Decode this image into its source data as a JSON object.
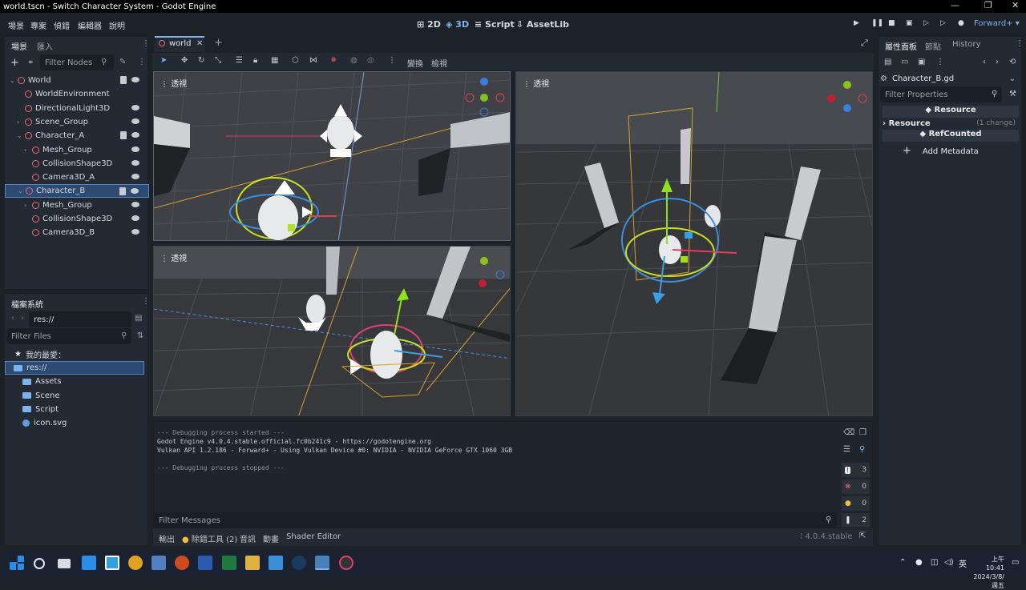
{
  "window": {
    "title": "world.tscn - Switch Character System - Godot Engine"
  },
  "menu": [
    "場景",
    "專案",
    "偵錯",
    "編輯器",
    "說明"
  ],
  "modes": {
    "two_d": "2D",
    "three_d": "3D",
    "script": "Script",
    "assetlib": "AssetLib"
  },
  "renderer": "Forward+",
  "scene_dock": {
    "tabs": [
      "場景",
      "匯入"
    ],
    "filter_placeholder": "Filter Nodes",
    "nodes": [
      {
        "label": "World",
        "indent": 0,
        "icon": "node3d-icon",
        "color": "#f06b6b",
        "script": true,
        "eye": true
      },
      {
        "label": "WorldEnvironment",
        "indent": 1,
        "icon": "globe-icon",
        "color": "#f06b6b",
        "script": false,
        "eye": false
      },
      {
        "label": "DirectionalLight3D",
        "indent": 1,
        "icon": "light-icon",
        "color": "#f06b6b",
        "script": false,
        "eye": true
      },
      {
        "label": "Scene_Group",
        "indent": 1,
        "icon": "node3d-icon",
        "color": "#f06b6b",
        "script": false,
        "eye": true
      },
      {
        "label": "Character_A",
        "indent": 1,
        "icon": "body-icon",
        "color": "#f06b6b",
        "script": true,
        "eye": true
      },
      {
        "label": "Mesh_Group",
        "indent": 2,
        "icon": "node3d-icon",
        "color": "#f06b6b",
        "script": false,
        "eye": true
      },
      {
        "label": "CollisionShape3D",
        "indent": 2,
        "icon": "collision-icon",
        "color": "#f06b6b",
        "script": false,
        "eye": true
      },
      {
        "label": "Camera3D_A",
        "indent": 2,
        "icon": "camera-icon",
        "color": "#f06b6b",
        "script": false,
        "eye": true
      },
      {
        "label": "Character_B",
        "indent": 1,
        "icon": "body-icon",
        "color": "#f06b6b",
        "script": true,
        "eye": true,
        "selected": true
      },
      {
        "label": "Mesh_Group",
        "indent": 2,
        "icon": "node3d-icon",
        "color": "#f06b6b",
        "script": false,
        "eye": true
      },
      {
        "label": "CollisionShape3D",
        "indent": 2,
        "icon": "collision-icon",
        "color": "#f06b6b",
        "script": false,
        "eye": true
      },
      {
        "label": "Camera3D_B",
        "indent": 2,
        "icon": "camera-icon",
        "color": "#f06b6b",
        "script": false,
        "eye": true
      }
    ]
  },
  "filesystem": {
    "title": "檔案系統",
    "path": "res://",
    "filter_placeholder": "Filter Files",
    "favorites": "我的最愛：",
    "items": [
      {
        "label": "res://",
        "indent": 0,
        "type": "folder"
      },
      {
        "label": "Assets",
        "indent": 1,
        "type": "folder"
      },
      {
        "label": "Scene",
        "indent": 1,
        "type": "folder"
      },
      {
        "label": "Script",
        "indent": 1,
        "type": "folder"
      },
      {
        "label": "icon.svg",
        "indent": 1,
        "type": "file"
      }
    ]
  },
  "editor": {
    "scene_tab": "world",
    "toolbar_labels": {
      "transform": "變換",
      "view": "檢視"
    },
    "viewport_label": "透視"
  },
  "output": {
    "lines": [
      "--- Debugging process started ---",
      "Godot Engine v4.0.4.stable.official.fc0b241c9 - https://godotengine.org",
      "Vulkan API 1.2.186 - Forward+ - Using Vulkan Device #0: NVIDIA - NVIDIA GeForce GTX 1060 3GB",
      "",
      "--- Debugging process stopped ---"
    ],
    "filter_placeholder": "Filter Messages",
    "counts": {
      "messages": "3",
      "errors": "0",
      "warnings": "0",
      "editor": "2"
    }
  },
  "bottom_tabs": [
    "輸出",
    "除錯工具 (2)",
    "音訊",
    "動畫",
    "Shader Editor"
  ],
  "version": "4.0.4.stable",
  "inspector": {
    "tabs": [
      "屬性面板",
      "節點",
      "History"
    ],
    "resource_path": "Character_B.gd",
    "filter_placeholder": "Filter Properties",
    "section_resource": "Resource",
    "row_resource": "Resource",
    "row_change": "(1 change)",
    "section_refcounted": "RefCounted",
    "add_metadata": "Add Metadata"
  },
  "taskbar": {
    "time": "上午 10:41",
    "date": "2024/3/8/週五"
  },
  "colors": {
    "accent": "#7bb4f0",
    "node_red": "#f06b6b",
    "bg": "#1d2229",
    "panel": "#232a33"
  }
}
